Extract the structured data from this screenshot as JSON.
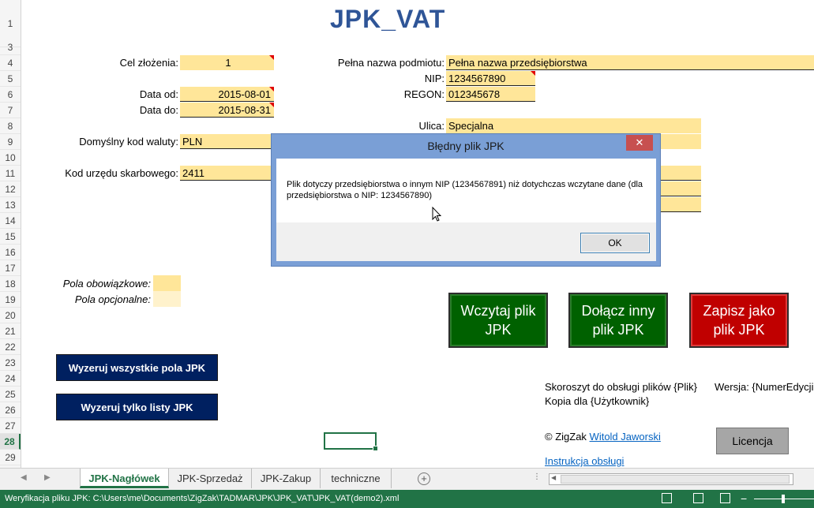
{
  "title": "JPK_VAT",
  "rows": [
    "1",
    "3",
    "4",
    "5",
    "6",
    "7",
    "8",
    "9",
    "10",
    "11",
    "12",
    "13",
    "14",
    "15",
    "16",
    "17",
    "18",
    "19",
    "20",
    "21",
    "22",
    "23",
    "24",
    "25",
    "26",
    "27",
    "28",
    "29"
  ],
  "form_left": {
    "cel_label": "Cel złożenia:",
    "cel_value": "1",
    "data_od_label": "Data od:",
    "data_od_value": "2015-08-01",
    "data_do_label": "Data do:",
    "data_do_value": "2015-08-31",
    "waluta_label": "Domyślny kod waluty:",
    "waluta_value": "PLN",
    "urzad_label": "Kod urzędu skarbowego:",
    "urzad_value": "2411"
  },
  "form_right": {
    "nazwa_label": "Pełna nazwa podmiotu:",
    "nazwa_value": "Pełna nazwa przedsiębiorstwa",
    "nip_label": "NIP:",
    "nip_value": "1234567890",
    "regon_label": "REGON:",
    "regon_value": "012345678",
    "ulica_label": "Ulica:",
    "ulica_value": "Specjalna"
  },
  "legend": {
    "required_label": "Pola obowiązkowe:",
    "optional_label": "Pola opcjonalne:"
  },
  "buttons": {
    "wczytaj": "Wczytaj plik JPK",
    "dolacz": "Dołącz inny plik JPK",
    "zapisz": "Zapisz jako plik JPK",
    "wyzeruj_all": "Wyzeruj  wszystkie pola JPK",
    "wyzeruj_listy": "Wyzeruj tylko listy JPK",
    "licencja": "Licencja"
  },
  "info": {
    "skoroszyt": "Skoroszyt do obsługi plików {Plik}",
    "wersja": "Wersja: {NumerEdycji",
    "kopia": "Kopia dla {Użytkownik}",
    "copyright": "© ZigZak ",
    "author": "Witold Jaworski",
    "instrukcja": "Instrukcja obsługi"
  },
  "dialog": {
    "title": "Błędny plik JPK",
    "close": "✕",
    "message": "Plik dotyczy przedsiębiorstwa o innym NIP (1234567891) niż dotychczas wczytane dane (dla przedsiębiorstwa o NIP: 1234567890)",
    "ok": "OK"
  },
  "tabs": {
    "t1": "JPK-Nagłówek",
    "t2": "JPK-Sprzedaż",
    "t3": "JPK-Zakup",
    "t4": "techniczne"
  },
  "status": {
    "text": "Weryfikacja pliku JPK: C:\\Users\\me\\Documents\\ZigZak\\TADMAR\\JPK\\JPK_VAT\\JPK_VAT(demo2).xml"
  },
  "colors": {
    "required_fill": "#ffe699",
    "optional_fill": "#fff2cc",
    "title": "#2f5597",
    "green_button": "#006100",
    "red_button": "#c00000",
    "navy_button": "#002060",
    "statusbar": "#217346"
  }
}
